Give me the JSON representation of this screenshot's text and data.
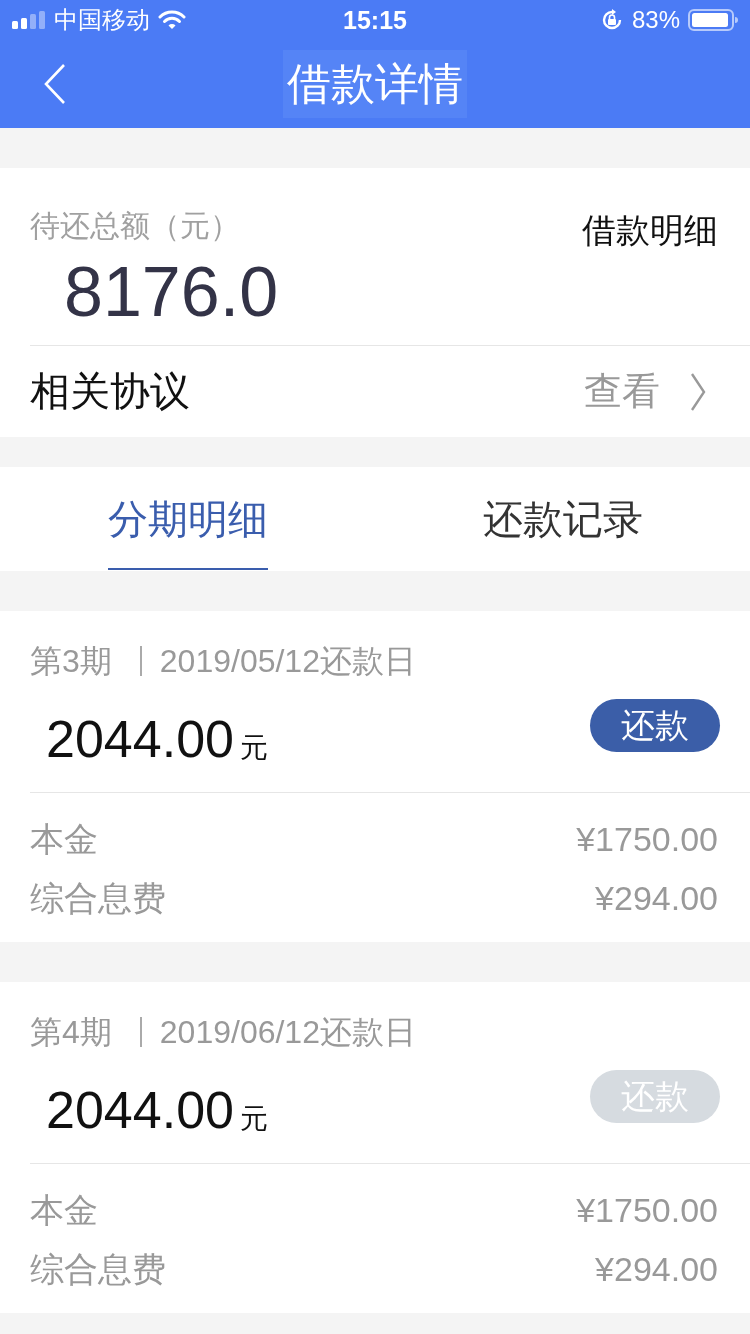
{
  "status_bar": {
    "carrier": "中国移动",
    "time": "15:15",
    "battery": "83%"
  },
  "nav": {
    "title": "借款详情"
  },
  "summary": {
    "label": "待还总额（元）",
    "amount": "8176.0",
    "detail_link": "借款明细"
  },
  "agreement": {
    "label": "相关协议",
    "action": "查看"
  },
  "tabs": [
    {
      "label": "分期明细",
      "selected": true
    },
    {
      "label": "还款记录",
      "selected": false
    }
  ],
  "installments": [
    {
      "period": "第3期",
      "due_date": "2019/05/12还款日",
      "amount": "2044.00",
      "unit": "元",
      "button": {
        "label": "还款",
        "disabled": false
      },
      "items": [
        {
          "label": "本金",
          "value": "¥1750.00"
        },
        {
          "label": "综合息费",
          "value": "¥294.00"
        }
      ]
    },
    {
      "period": "第4期",
      "due_date": "2019/06/12还款日",
      "amount": "2044.00",
      "unit": "元",
      "button": {
        "label": "还款",
        "disabled": true
      },
      "items": [
        {
          "label": "本金",
          "value": "¥1750.00"
        },
        {
          "label": "综合息费",
          "value": "¥294.00"
        }
      ]
    }
  ]
}
